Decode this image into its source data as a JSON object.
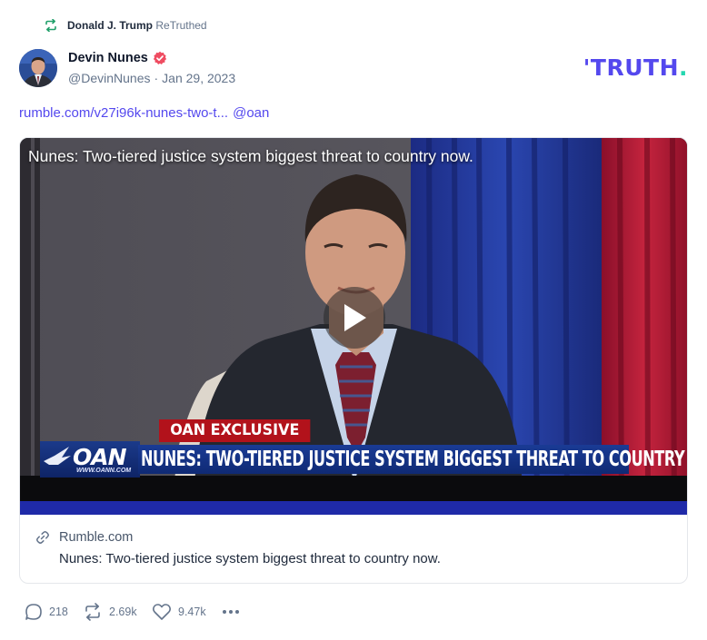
{
  "retruth": {
    "user": "Donald J. Trump",
    "verb": "ReTruthed",
    "icon": "retruth-icon",
    "icon_color": "#22a06b"
  },
  "author": {
    "name": "Devin Nunes",
    "handle": "@DevinNunes",
    "separator": "·",
    "date": "Jan 29, 2023",
    "verified_icon": "verified-badge-icon",
    "verified_color": "#ef4c61"
  },
  "brand": {
    "logo_main": "TRUTH",
    "logo_dot": ".",
    "logo_color": "#5448ee",
    "dot_color": "#25d7b0"
  },
  "post": {
    "link": "rumble.com/v27i96k-nunes-two-t...",
    "mention": "@oan"
  },
  "video": {
    "title": "Nunes: Two-tiered justice system biggest threat to country now.",
    "chyron_tag": "OAN EXCLUSIVE",
    "network": "OAN",
    "network_url": "WWW.OANN.COM",
    "headline": "NUNES: TWO-TIERED JUSTICE SYSTEM BIGGEST THREAT TO COUNTRY NOW"
  },
  "card": {
    "source": "Rumble.com",
    "description": "Nunes: Two-tiered justice system biggest threat to country now."
  },
  "actions": {
    "replies": "218",
    "retruths": "2.69k",
    "likes": "9.47k"
  },
  "colors": {
    "accent": "#5448ee",
    "muted": "#64748b"
  }
}
